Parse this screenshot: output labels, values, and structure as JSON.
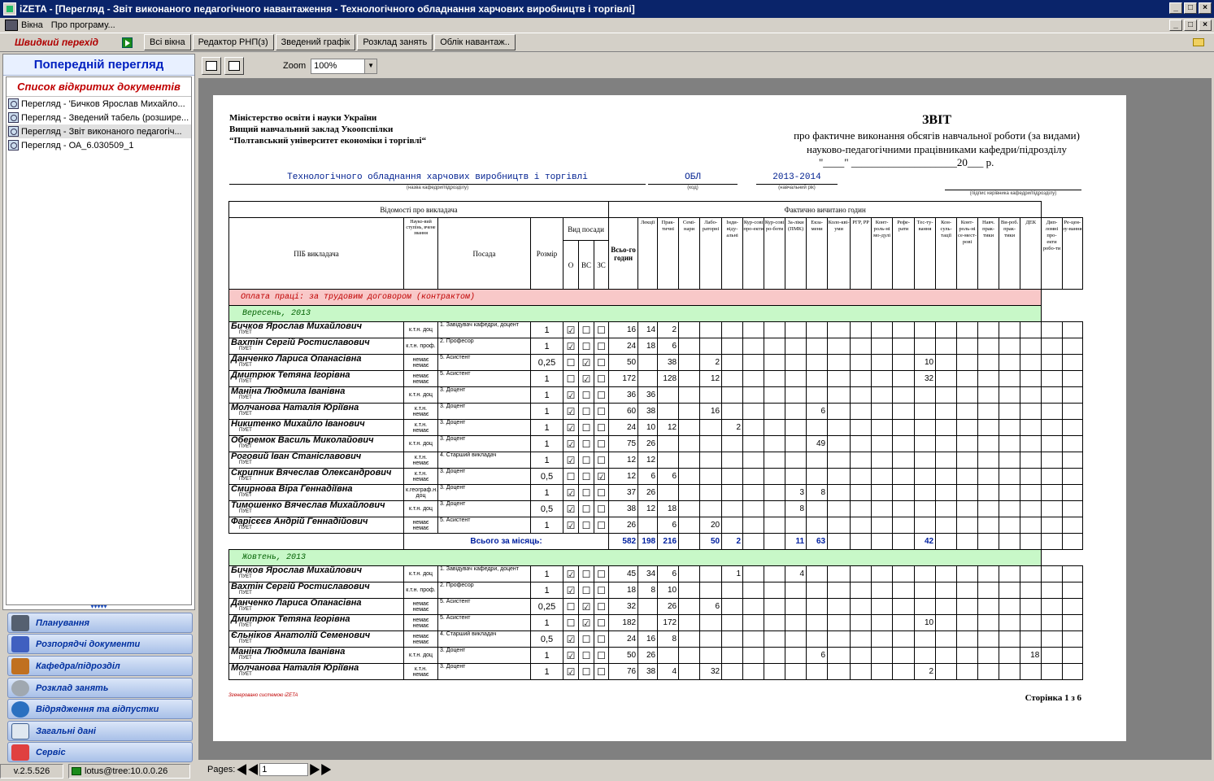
{
  "window": {
    "title": "iZETA - [Перегляд - Звіт виконаного педагогічного навантаження - Технологічного обладнання харчових виробництв і торгівлі]"
  },
  "menu": {
    "items": [
      "Вікна",
      "Про програму..."
    ]
  },
  "toolbar": {
    "quick": "Швидкий перехід",
    "buttons": [
      "Всі вікна",
      "Редактор РНП(з)",
      "Зведений графік",
      "Розклад занять",
      "Облік навантаж.."
    ]
  },
  "left": {
    "header": "Попередній перегляд",
    "list_title": "Список відкритих документів",
    "docs": [
      "Перегляд - 'Бичков Ярослав Михайло...",
      "Перегляд - Зведений табель (розшире...",
      "Перегляд - Звіт виконаного педагогіч...",
      "Перегляд - ОА_6.030509_1"
    ],
    "nav": [
      "Планування",
      "Розпорядчі документи",
      "Кафедра/підрозділ",
      "Розклад занять",
      "Відрядження та відпустки",
      "Загальні дані",
      "Сервіс"
    ]
  },
  "status": {
    "version": "v.2.5.526",
    "connection": "lotus@tree:10.0.0.26",
    "pages_label": "Pages:",
    "page": "1"
  },
  "preview": {
    "zoom_label": "Zoom",
    "zoom": "100%"
  },
  "report": {
    "org": [
      "Міністерство освіти і науки України",
      "Вищий навчальний заклад Укоопспілки",
      "“Полтавський університет економіки і торгівлі“"
    ],
    "title": "ЗВІТ",
    "subtitle1": "про фактичне виконання обсягів навчальної роботи (за видами)",
    "subtitle2": "науково-педагогічними працівниками кафедри/підрозділу",
    "date_line": "\"____\" ____________________20___ р.",
    "dept": "Технологічного обладнання харчових виробництв і торгівлі",
    "dept_caption": "(назва кафедри/підрозділу)",
    "code": "ОБЛ",
    "code_caption": "(код)",
    "year": "2013-2014",
    "year_caption": "(навчальний рік)",
    "sign_caption": "(підпис керівника кафедри/підрозділу)",
    "hdr": {
      "info": "Відомості про викладача",
      "fact": "Фактично вичитано годин",
      "name": "ПІБ викладача",
      "degree": "Науко-вий ступінь, вчене звання",
      "position": "Посада",
      "size": "Розмір",
      "kind": "Вид посади",
      "o": "О",
      "vs": "ВС",
      "zs": "ЗС",
      "total": "Всьо-го годин"
    },
    "cols": [
      "Лекції",
      "Прак-тичні",
      "Семі-нари",
      "Лабо-раторні",
      "Інди-віду-альні",
      "Кур-сові про-екти",
      "Кур-сові ро-боти",
      "За-ліки (ПМК)",
      "Екза-мени",
      "Коло-кві-уми",
      "РГР, РР",
      "Конт-роль-ні мо-дулі",
      "Рефе-рати",
      "Тес-ту-вання",
      "Кон-суль-тації",
      "Конт-роль-ні се-мест-рові",
      "Навч. прак-тики",
      "Ви-роб. прак-тики",
      "ДЕК",
      "Дип-ломні про-екти робо-ти",
      "Ре-цен-зу-вання"
    ],
    "band": "Оплата праці: за трудовим договором (контрактом)",
    "months": [
      {
        "name": "Вересень, 2013",
        "rows": [
          {
            "n": "Бичков Ярослав Михайлович",
            "d": "к.т.н. доц",
            "p": "1. Завідувач кафедри, доцент",
            "s": "1",
            "k": "O",
            "t": "16",
            "v": {
              "0": "14",
              "1": "2"
            }
          },
          {
            "n": "Вахтін Сергій Ростиславович",
            "d": "к.т.н. проф.",
            "p": "2. Професор",
            "s": "1",
            "k": "O",
            "t": "24",
            "v": {
              "0": "18",
              "1": "6"
            }
          },
          {
            "n": "Данченко Лариса Опанасівна",
            "d": "немає немає",
            "p": "5. Асистент",
            "s": "0,25",
            "k": "VS",
            "t": "50",
            "v": {
              "1": "38",
              "3": "2",
              "13": "10"
            }
          },
          {
            "n": "Дмитрюк Тетяна Ігорівна",
            "d": "немає немає",
            "p": "5. Асистент",
            "s": "1",
            "k": "VS",
            "t": "172",
            "v": {
              "1": "128",
              "3": "12",
              "13": "32"
            }
          },
          {
            "n": "Маніна Людмила Іванівна",
            "d": "к.т.н. доц",
            "p": "3. Доцент",
            "s": "1",
            "k": "O",
            "t": "36",
            "v": {
              "0": "36"
            }
          },
          {
            "n": "Молчанова Наталія Юріївна",
            "d": "к.т.н. немає",
            "p": "3. Доцент",
            "s": "1",
            "k": "O",
            "t": "60",
            "v": {
              "0": "38",
              "3": "16",
              "8": "6"
            }
          },
          {
            "n": "Никитенко Михайло Іванович",
            "d": "к.т.н. немає",
            "p": "3. Доцент",
            "s": "1",
            "k": "O",
            "t": "24",
            "v": {
              "0": "10",
              "1": "12",
              "4": "2"
            }
          },
          {
            "n": "Оберемок Василь Миколайович",
            "d": "к.т.н. доц",
            "p": "3. Доцент",
            "s": "1",
            "k": "O",
            "t": "75",
            "v": {
              "0": "26",
              "8": "49"
            }
          },
          {
            "n": "Роговий Іван Станіславович",
            "d": "к.т.н. немає",
            "p": "4. Старший викладач",
            "s": "1",
            "k": "O",
            "t": "12",
            "v": {
              "0": "12"
            }
          },
          {
            "n": "Скрипник Вячеслав Олександрович",
            "d": "к.т.н. немає",
            "p": "3. Доцент",
            "s": "0,5",
            "k": "ZS",
            "t": "12",
            "v": {
              "0": "6",
              "1": "6"
            }
          },
          {
            "n": "Смирнова Віра Геннадіївна",
            "d": "к.географ.н. доц",
            "p": "3. Доцент",
            "s": "1",
            "k": "O",
            "t": "37",
            "v": {
              "0": "26",
              "7": "3",
              "8": "8"
            }
          },
          {
            "n": "Тимошенко Вячеслав Михайлович",
            "d": "к.т.н. доц",
            "p": "3. Доцент",
            "s": "0,5",
            "k": "O",
            "t": "38",
            "v": {
              "0": "12",
              "1": "18",
              "7": "8"
            }
          },
          {
            "n": "Фарісєєв Андрій Геннадійович",
            "d": "немає немає",
            "p": "5. Асистент",
            "s": "1",
            "k": "O",
            "t": "26",
            "v": {
              "1": "6",
              "3": "20"
            }
          }
        ],
        "total": {
          "label": "Всього за місяць:",
          "t": "582",
          "v": {
            "0": "198",
            "1": "216",
            "3": "50",
            "4": "2",
            "7": "11",
            "8": "63",
            "13": "42"
          }
        }
      },
      {
        "name": "Жовтень, 2013",
        "rows": [
          {
            "n": "Бичков Ярослав Михайлович",
            "d": "к.т.н. доц",
            "p": "1. Завідувач кафедри, доцент",
            "s": "1",
            "k": "O",
            "t": "45",
            "v": {
              "0": "34",
              "1": "6",
              "4": "1",
              "7": "4"
            }
          },
          {
            "n": "Вахтін Сергій Ростиславович",
            "d": "к.т.н. проф.",
            "p": "2. Професор",
            "s": "1",
            "k": "O",
            "t": "18",
            "v": {
              "0": "8",
              "1": "10"
            }
          },
          {
            "n": "Данченко Лариса Опанасівна",
            "d": "немає немає",
            "p": "5. Асистент",
            "s": "0,25",
            "k": "VS",
            "t": "32",
            "v": {
              "1": "26",
              "3": "6"
            }
          },
          {
            "n": "Дмитрюк Тетяна Ігорівна",
            "d": "немає немає",
            "p": "5. Асистент",
            "s": "1",
            "k": "VS",
            "t": "182",
            "v": {
              "1": "172",
              "13": "10"
            }
          },
          {
            "n": "Єльніков Анатолій Семенович",
            "d": "немає немає",
            "p": "4. Старший викладач",
            "s": "0,5",
            "k": "O",
            "t": "24",
            "v": {
              "0": "16",
              "1": "8"
            }
          },
          {
            "n": "Маніна Людмила Іванівна",
            "d": "к.т.н. доц",
            "p": "3. Доцент",
            "s": "1",
            "k": "O",
            "t": "50",
            "v": {
              "0": "26",
              "8": "6",
              "18": "18"
            }
          },
          {
            "n": "Молчанова Наталія Юріївна",
            "d": "к.т.н. немає",
            "p": "3. Доцент",
            "s": "1",
            "k": "O",
            "t": "76",
            "v": {
              "0": "38",
              "1": "4",
              "3": "32",
              "13": "2"
            }
          }
        ]
      }
    ],
    "org_suffix": "ПУЕТ",
    "footer_left": "Згенеровано системою iZETA",
    "footer_right": "Сторінка 1 з 6"
  }
}
